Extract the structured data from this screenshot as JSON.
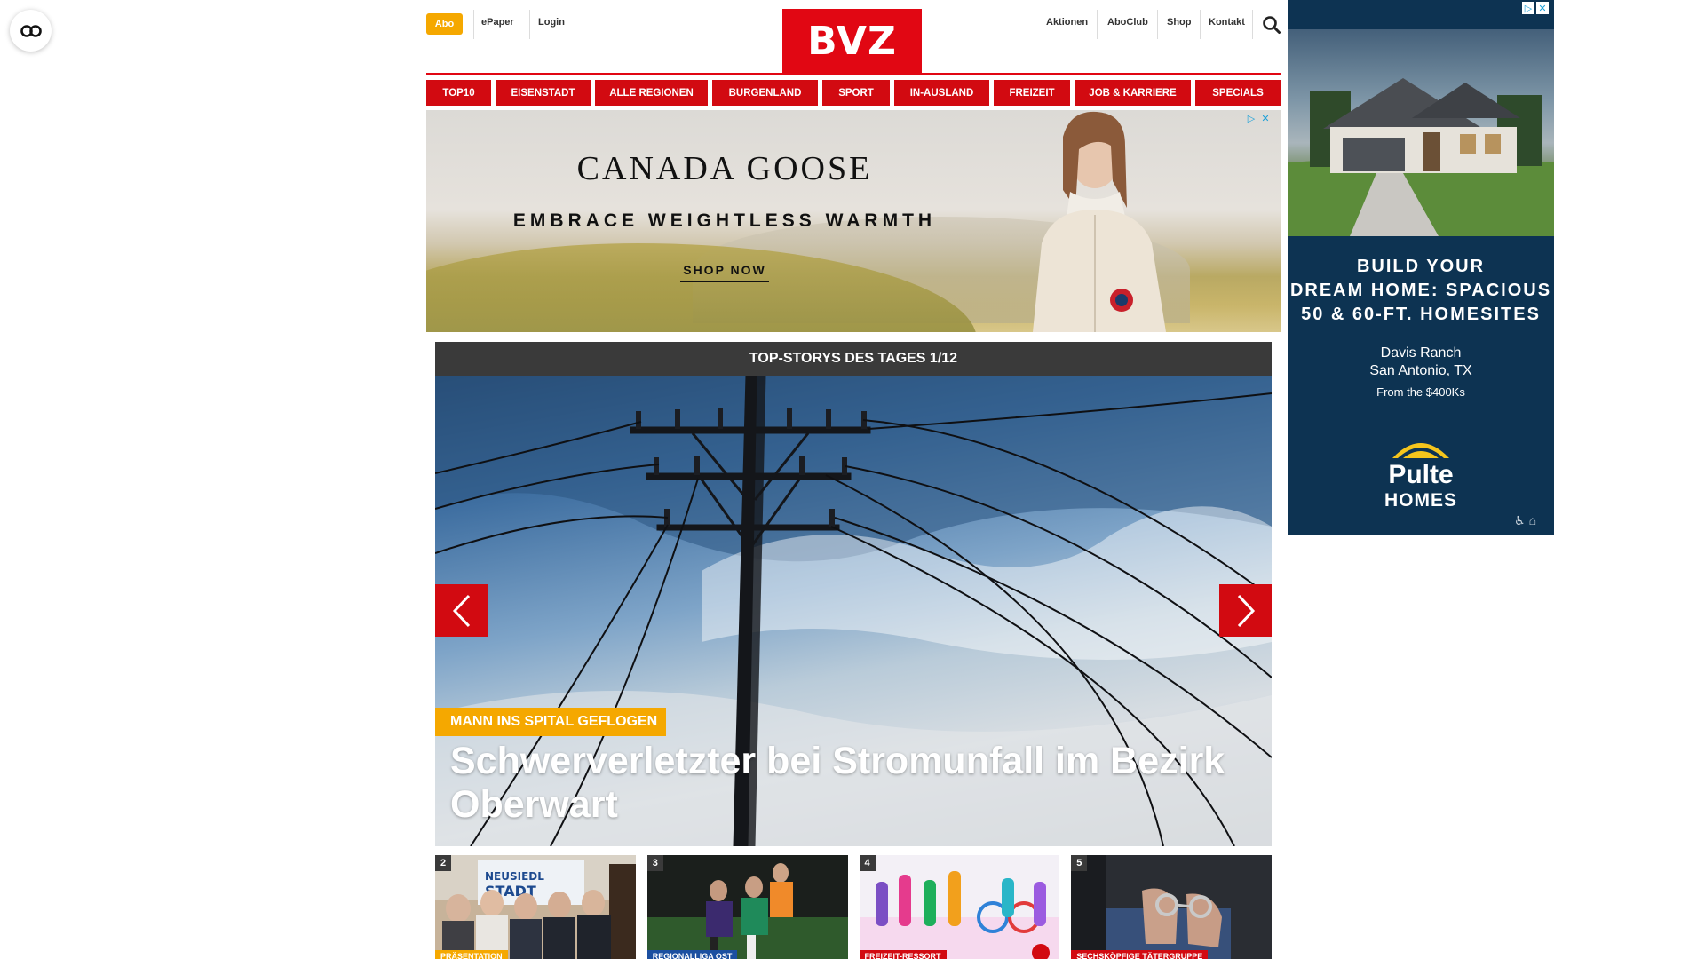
{
  "header": {
    "abo_label": "Abo",
    "epaper_label": "ePaper",
    "login_label": "Login",
    "logo_text": "BVZ",
    "links": [
      "Aktionen",
      "AboClub",
      "Shop",
      "Kontakt"
    ],
    "brand_color": "#e10713",
    "accent_color": "#f5a800"
  },
  "nav": {
    "items": [
      "TOP10",
      "EISENSTADT",
      "ALLE REGIONEN",
      "BURGENLAND",
      "SPORT",
      "IN-AUSLAND",
      "FREIZEIT",
      "JOB & KARRIERE",
      "SPECIALS"
    ]
  },
  "banner_ad": {
    "brand": "CANADA GOOSE",
    "tagline": "EMBRACE WEIGHTLESS WARMTH",
    "cta": "SHOP NOW"
  },
  "top_stories": {
    "header": "TOP-STORYS DES TAGES 1/12",
    "hero": {
      "kicker": "MANN INS SPITAL GEFLOGEN",
      "title": "Schwerverletzter bei Stromunfall im Bezirk Oberwart"
    },
    "thumbs": [
      {
        "num": "2",
        "tag": "PRÄSENTATION",
        "tag_color": "#f5a800"
      },
      {
        "num": "3",
        "tag": "REGIONALLIGA OST",
        "tag_color": "#1b4fa0"
      },
      {
        "num": "4",
        "tag": "FREIZEIT-RESSORT",
        "tag_color": "#d20a11"
      },
      {
        "num": "5",
        "tag": "SECHSKÖPFIGE TÄTERGRUPPE",
        "tag_color": "#d20a11"
      }
    ]
  },
  "side_ad": {
    "headline_lines": [
      "BUILD YOUR",
      "DREAM HOME: SPACIOUS",
      "50 & 60-FT. HOMESITES"
    ],
    "location_lines": [
      "Davis Ranch",
      "San Antonio, TX"
    ],
    "price": "From the $400Ks",
    "logo_top": "Pulte",
    "logo_bottom": "HOMES"
  }
}
